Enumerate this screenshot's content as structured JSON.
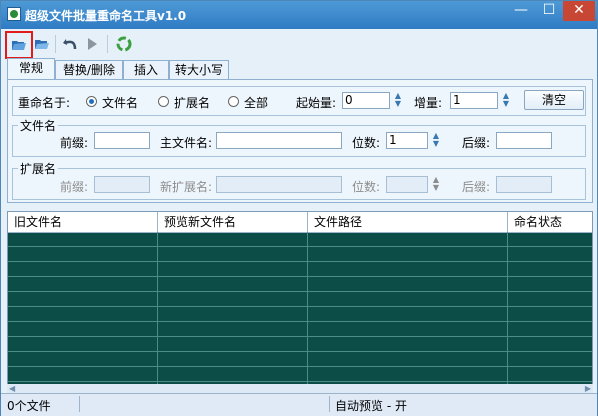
{
  "window": {
    "title": "超级文件批量重命名工具v1.0",
    "min": "—",
    "max": "☐",
    "close": "✕"
  },
  "toolbar": {
    "open_files": "open-files-icon",
    "open_folder": "open-folder-icon",
    "undo": "undo-icon",
    "run": "run-icon",
    "recycle": "recycle-icon"
  },
  "tabs": [
    {
      "label": "常规"
    },
    {
      "label": "替换/删除"
    },
    {
      "label": "插入"
    },
    {
      "label": "转大小写"
    }
  ],
  "rename": {
    "label": "重命名于:",
    "options": [
      {
        "label": "文件名",
        "selected": true
      },
      {
        "label": "扩展名",
        "selected": false
      },
      {
        "label": "全部",
        "selected": false
      }
    ],
    "start_label": "起始量:",
    "start_value": "0",
    "step_label": "增量:",
    "step_value": "1",
    "clear_label": "清空"
  },
  "filename_group": {
    "title": "文件名",
    "prefix_label": "前缀:",
    "prefix_value": "",
    "main_label": "主文件名:",
    "main_value": "",
    "digits_label": "位数:",
    "digits_value": "1",
    "suffix_label": "后缀:",
    "suffix_value": ""
  },
  "ext_group": {
    "title": "扩展名",
    "prefix_label": "前缀:",
    "new_ext_label": "新扩展名:",
    "digits_label": "位数:",
    "suffix_label": "后缀:"
  },
  "table": {
    "columns": [
      "旧文件名",
      "预览新文件名",
      "文件路径",
      "命名状态"
    ]
  },
  "status": {
    "file_count": "0个文件",
    "auto_preview": "自动预览 - 开"
  },
  "colors": {
    "titlebar": "#3a89cf",
    "grid_background": "#0d4d47",
    "highlight": "#e11a1a"
  }
}
